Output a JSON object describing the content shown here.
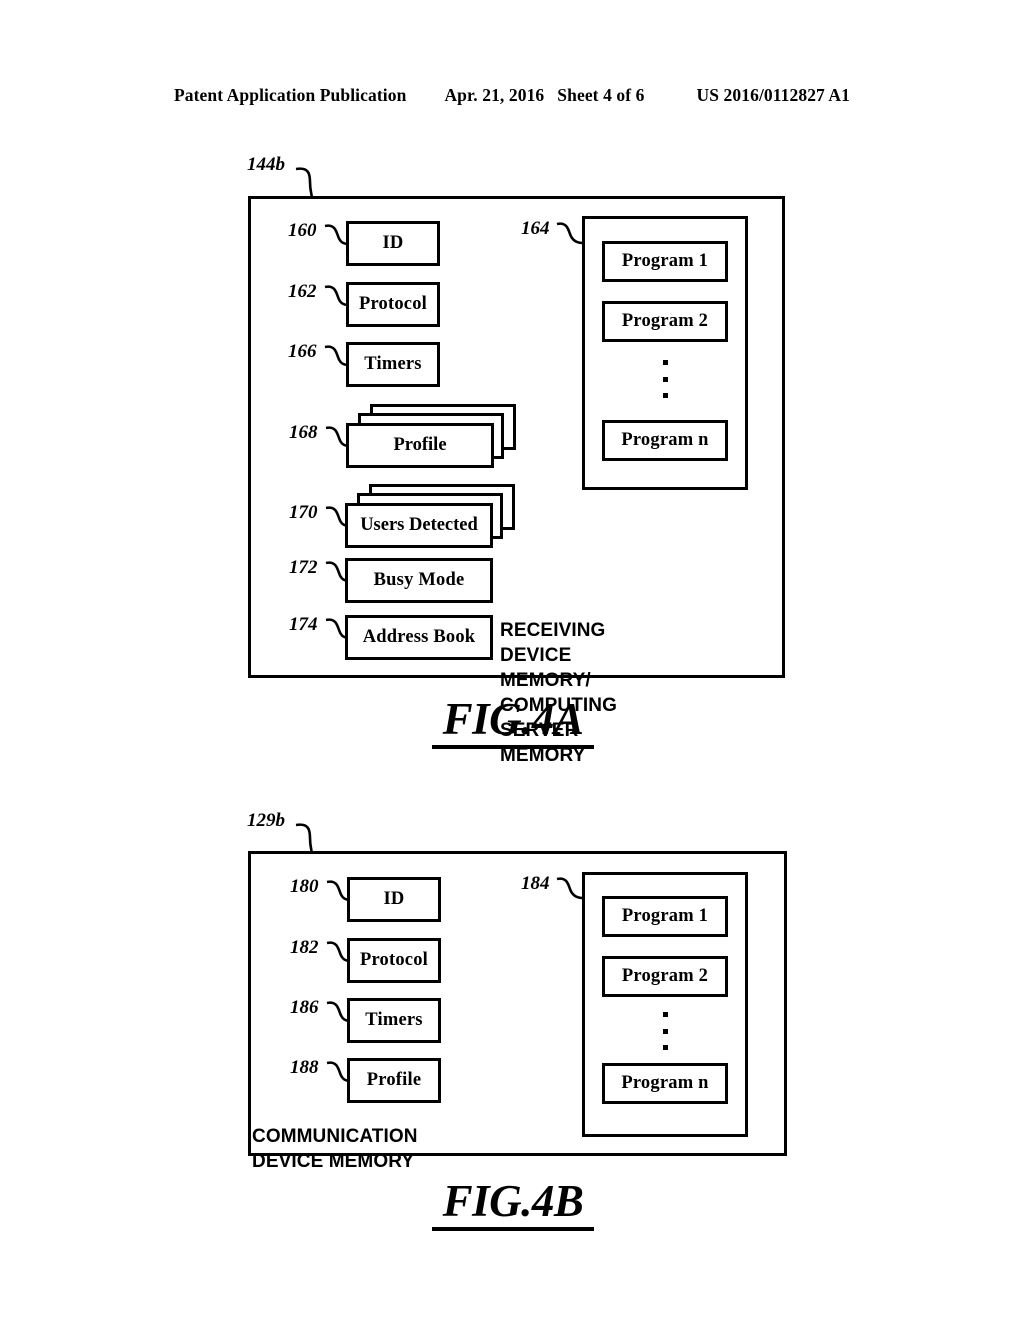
{
  "header": {
    "publication": "Patent Application Publication",
    "date": "Apr. 21, 2016",
    "sheet": "Sheet 4 of 6",
    "patent_number": "US 2016/0112827 A1"
  },
  "figures": [
    {
      "id": "fig-4a",
      "caption": "FIG.4A",
      "container_ref": "144b",
      "container_caption": "RECEIVING DEVICE MEMORY/\nCOMPUTING SERVER MEMORY",
      "items": [
        {
          "ref": "160",
          "label": "ID",
          "stacked": false,
          "wide": false
        },
        {
          "ref": "162",
          "label": "Protocol",
          "stacked": false,
          "wide": false
        },
        {
          "ref": "166",
          "label": "Timers",
          "stacked": false,
          "wide": false
        },
        {
          "ref": "168",
          "label": "Profile",
          "stacked": true,
          "wide": true
        },
        {
          "ref": "170",
          "label": "Users Detected",
          "stacked": true,
          "wide": true
        },
        {
          "ref": "172",
          "label": "Busy Mode",
          "stacked": false,
          "wide": true
        },
        {
          "ref": "174",
          "label": "Address Book",
          "stacked": false,
          "wide": true
        }
      ],
      "programs": {
        "ref": "164",
        "entries": [
          "Program 1",
          "Program 2"
        ],
        "ellipsis": "vertical-dots",
        "last_entry": "Program n"
      }
    },
    {
      "id": "fig-4b",
      "caption": "FIG.4B",
      "container_ref": "129b",
      "container_caption": "COMMUNICATION DEVICE MEMORY",
      "items": [
        {
          "ref": "180",
          "label": "ID",
          "stacked": false,
          "wide": false
        },
        {
          "ref": "182",
          "label": "Protocol",
          "stacked": false,
          "wide": false
        },
        {
          "ref": "186",
          "label": "Timers",
          "stacked": false,
          "wide": false
        },
        {
          "ref": "188",
          "label": "Profile",
          "stacked": false,
          "wide": false
        }
      ],
      "programs": {
        "ref": "184",
        "entries": [
          "Program 1",
          "Program 2"
        ],
        "ellipsis": "vertical-dots",
        "last_entry": "Program n"
      }
    }
  ],
  "colors": {
    "ink": "#000000",
    "paper": "#ffffff"
  }
}
